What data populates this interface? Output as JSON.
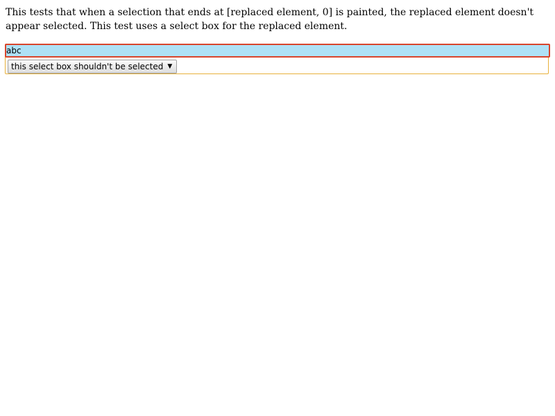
{
  "description": "This tests that when a selection that ends at [replaced element, 0] is painted, the replaced element doesn't appear selected. This test uses a select box for the replaced element.",
  "selected_text": "abc",
  "select": {
    "selected_value": "this select box shouldn't be selected",
    "arrow": "▼"
  },
  "colors": {
    "selection_background": "#aee1f6",
    "selection_border": "#d9452c",
    "editable_border": "#e8b03a"
  }
}
